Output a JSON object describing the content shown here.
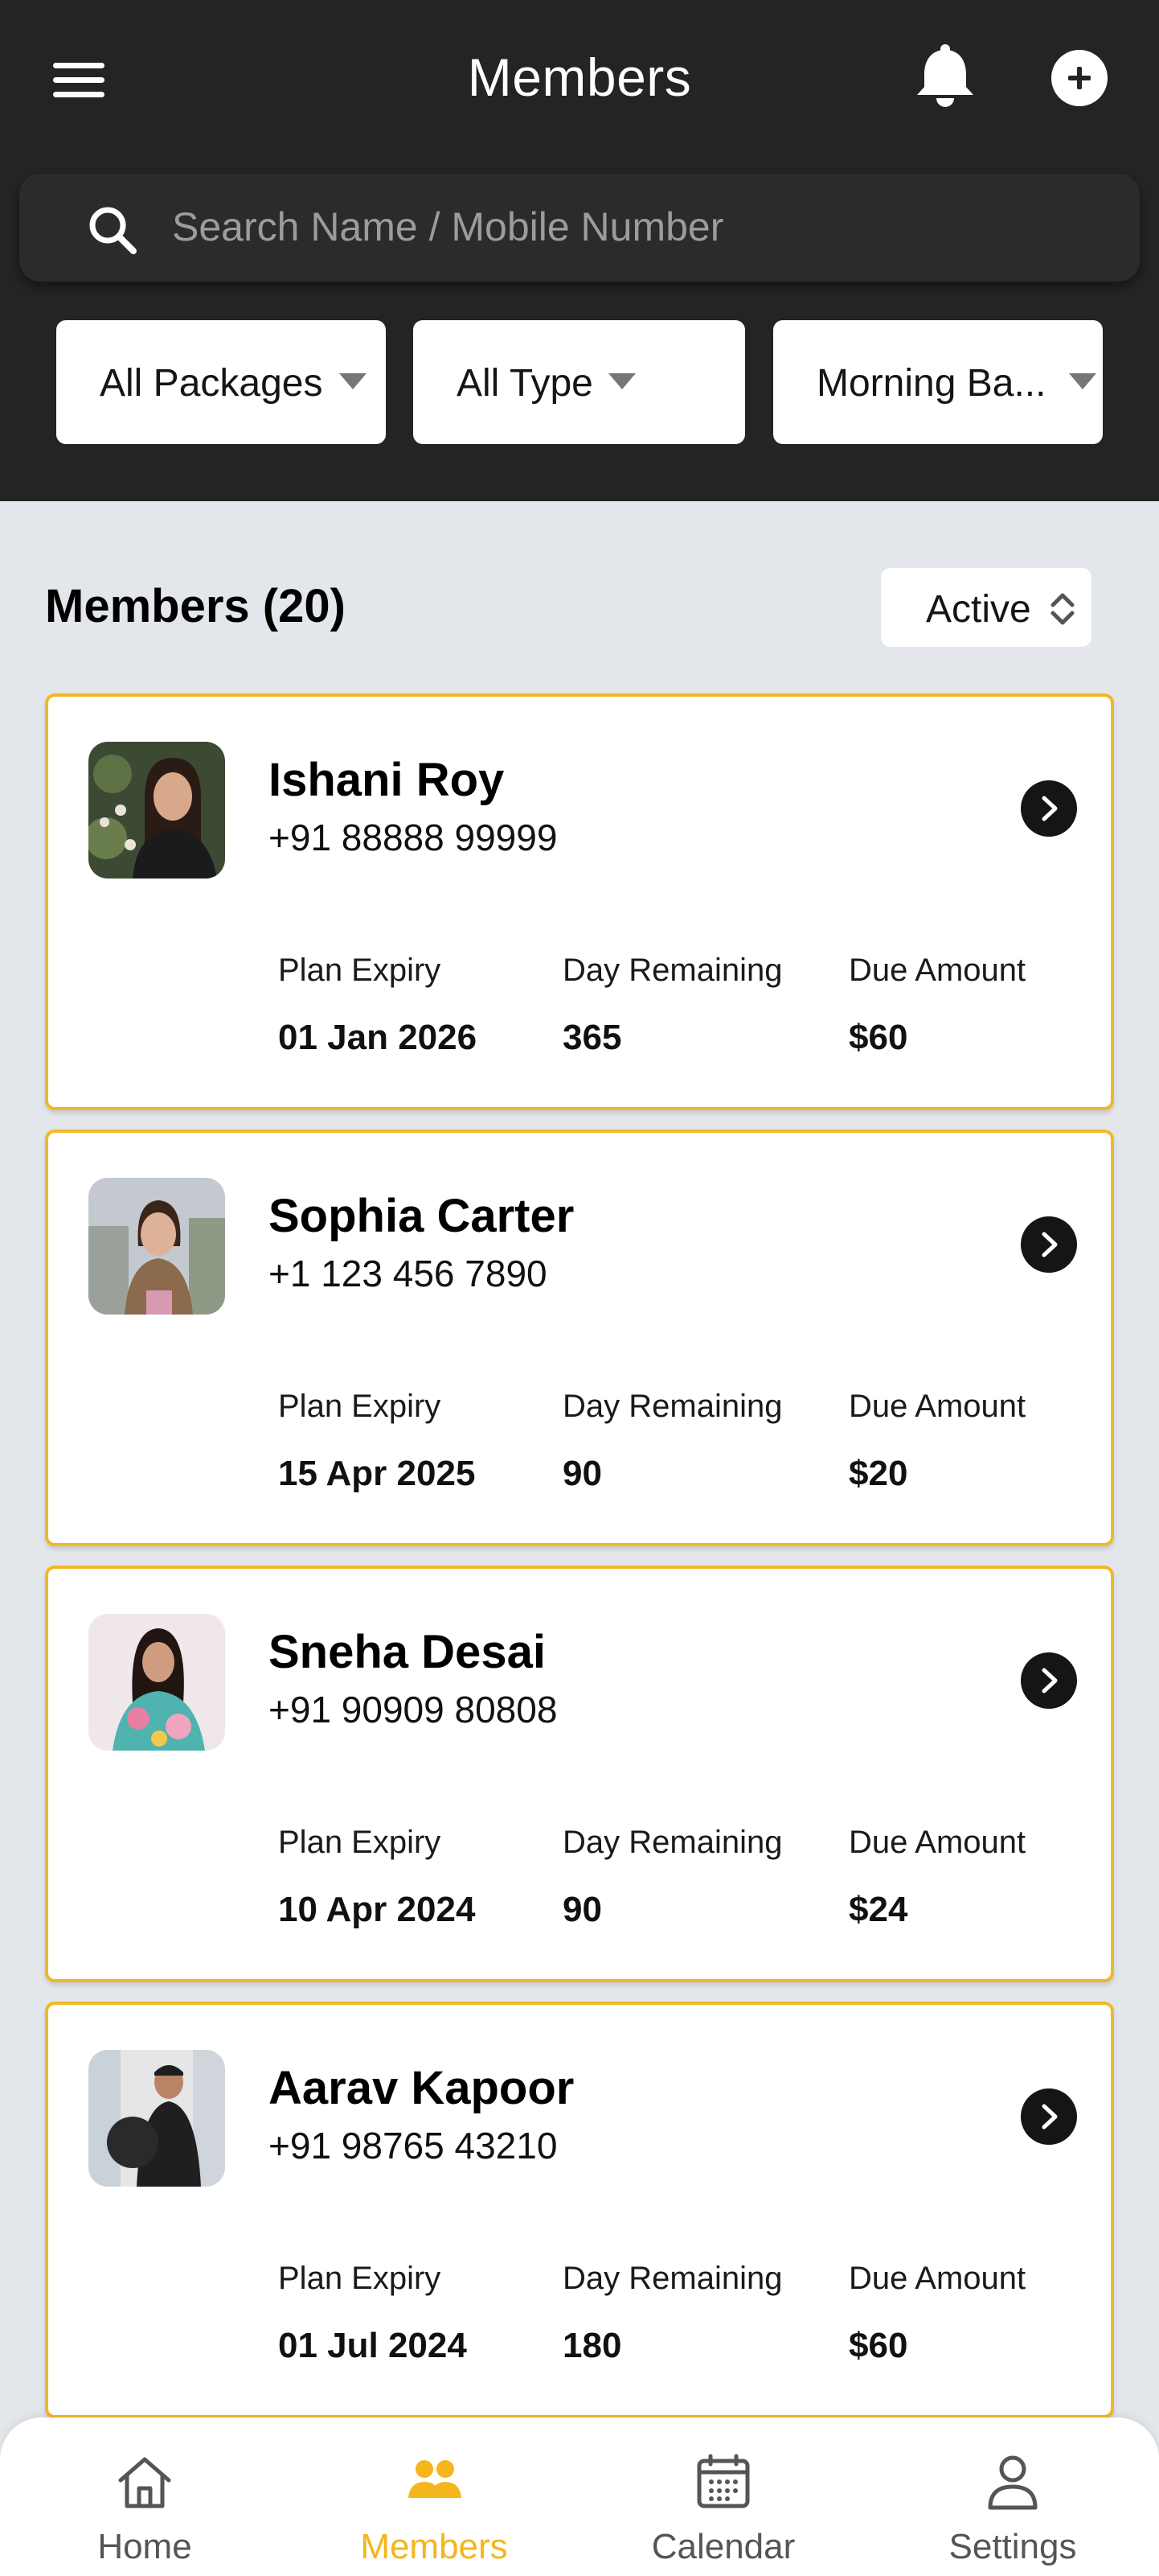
{
  "header": {
    "title": "Members",
    "search_placeholder": "Search Name / Mobile Number",
    "filters": [
      "All Packages",
      "All Type",
      "Morning Ba..."
    ]
  },
  "list": {
    "title": "Members (20)",
    "status": "Active",
    "labels": {
      "expiry": "Plan Expiry",
      "remaining": "Day Remaining",
      "due": "Due Amount"
    },
    "members": [
      {
        "name": "Ishani Roy",
        "phone": "+91 88888 99999",
        "expiry": "01 Jan 2026",
        "remaining": "365",
        "due": "$60"
      },
      {
        "name": "Sophia Carter",
        "phone": "+1 123 456 7890",
        "expiry": "15 Apr 2025",
        "remaining": "90",
        "due": "$20"
      },
      {
        "name": "Sneha Desai",
        "phone": "+91 90909 80808",
        "expiry": "10 Apr 2024",
        "remaining": "90",
        "due": "$24"
      },
      {
        "name": "Aarav Kapoor",
        "phone": "+91 98765 43210",
        "expiry": "01 Jul 2024",
        "remaining": "180",
        "due": "$60"
      }
    ]
  },
  "nav": {
    "items": [
      {
        "label": "Home",
        "icon": "home-icon"
      },
      {
        "label": "Members",
        "icon": "members-icon",
        "active": true
      },
      {
        "label": "Calendar",
        "icon": "calendar-icon"
      },
      {
        "label": "Settings",
        "icon": "user-icon"
      }
    ]
  },
  "colors": {
    "accent": "#f5b51c",
    "header_bg": "#242424",
    "page_bg": "#e3e6ea"
  }
}
